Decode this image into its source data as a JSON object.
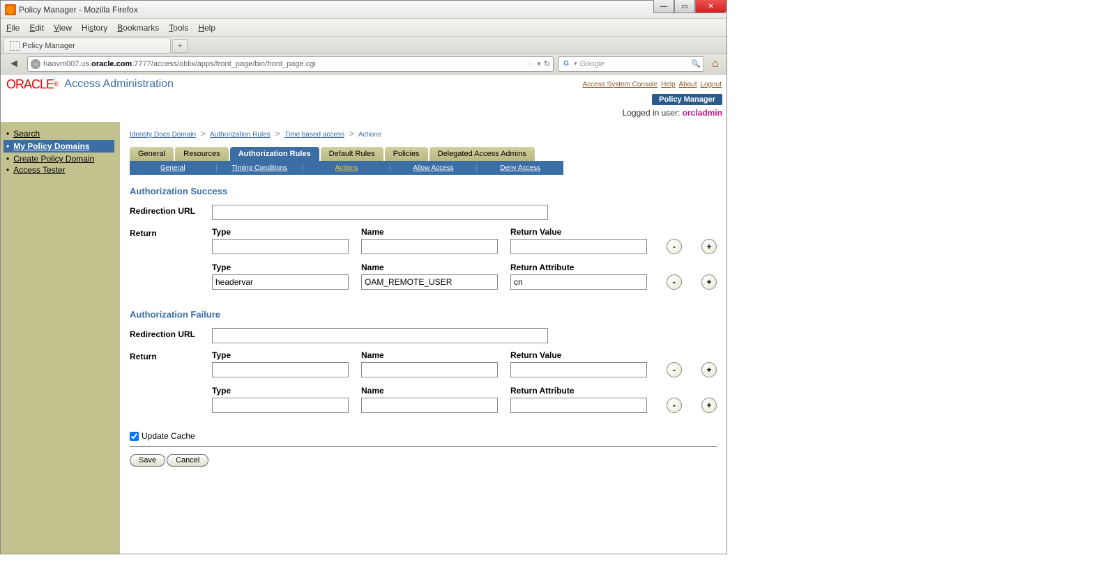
{
  "window": {
    "title": "Policy Manager - Mozilla Firefox"
  },
  "menubar": {
    "file": "File",
    "edit": "Edit",
    "view": "View",
    "history": "History",
    "bookmarks": "Bookmarks",
    "tools": "Tools",
    "help": "Help"
  },
  "tab": {
    "title": "Policy Manager"
  },
  "address": {
    "host": "haovm007.us.",
    "domain": "oracle.com",
    "path": ":7777/access/oblix/apps/front_page/bin/front_page.cgi"
  },
  "search": {
    "placeholder": "Google"
  },
  "brand": {
    "logo": "ORACLE",
    "subtitle": "Access Administration"
  },
  "header_links": {
    "console": "Access System Console",
    "help": "Help",
    "about": "About",
    "logout": "Logout"
  },
  "badge": "Policy Manager",
  "logged_in": {
    "label": "Logged in user: ",
    "user": "orcladmin"
  },
  "sidebar": {
    "items": [
      {
        "label": "Search"
      },
      {
        "label": "My Policy Domains"
      },
      {
        "label": "Create Policy Domain"
      },
      {
        "label": "Access Tester"
      }
    ]
  },
  "breadcrumb": {
    "l1": "Identity Docs Domain",
    "l2": "Authorization Rules",
    "l3": "Time based access",
    "l4": "Actions"
  },
  "toptabs": {
    "general": "General",
    "resources": "Resources",
    "auth_rules": "Authorization Rules",
    "default_rules": "Default Rules",
    "policies": "Policies",
    "delegated": "Delegated Access Admins"
  },
  "subtabs": {
    "general": "General",
    "timing": "Timing Conditions",
    "actions": "Actions",
    "allow": "Allow Access",
    "deny": "Deny Access"
  },
  "sections": {
    "success": "Authorization Success",
    "failure": "Authorization Failure"
  },
  "labels": {
    "redirection_url": "Redirection URL",
    "return": "Return",
    "type": "Type",
    "name": "Name",
    "return_value": "Return Value",
    "return_attribute": "Return Attribute",
    "update_cache": "Update Cache"
  },
  "form": {
    "success": {
      "redirection_url": "",
      "row1": {
        "type": "",
        "name": "",
        "return_value": ""
      },
      "row2": {
        "type": "headervar",
        "name": "OAM_REMOTE_USER",
        "return_attribute": "cn"
      }
    },
    "failure": {
      "redirection_url": "",
      "row1": {
        "type": "",
        "name": "",
        "return_value": ""
      },
      "row2": {
        "type": "",
        "name": "",
        "return_attribute": ""
      }
    }
  },
  "buttons": {
    "minus": "-",
    "plus": "+",
    "save": "Save",
    "cancel": "Cancel"
  }
}
